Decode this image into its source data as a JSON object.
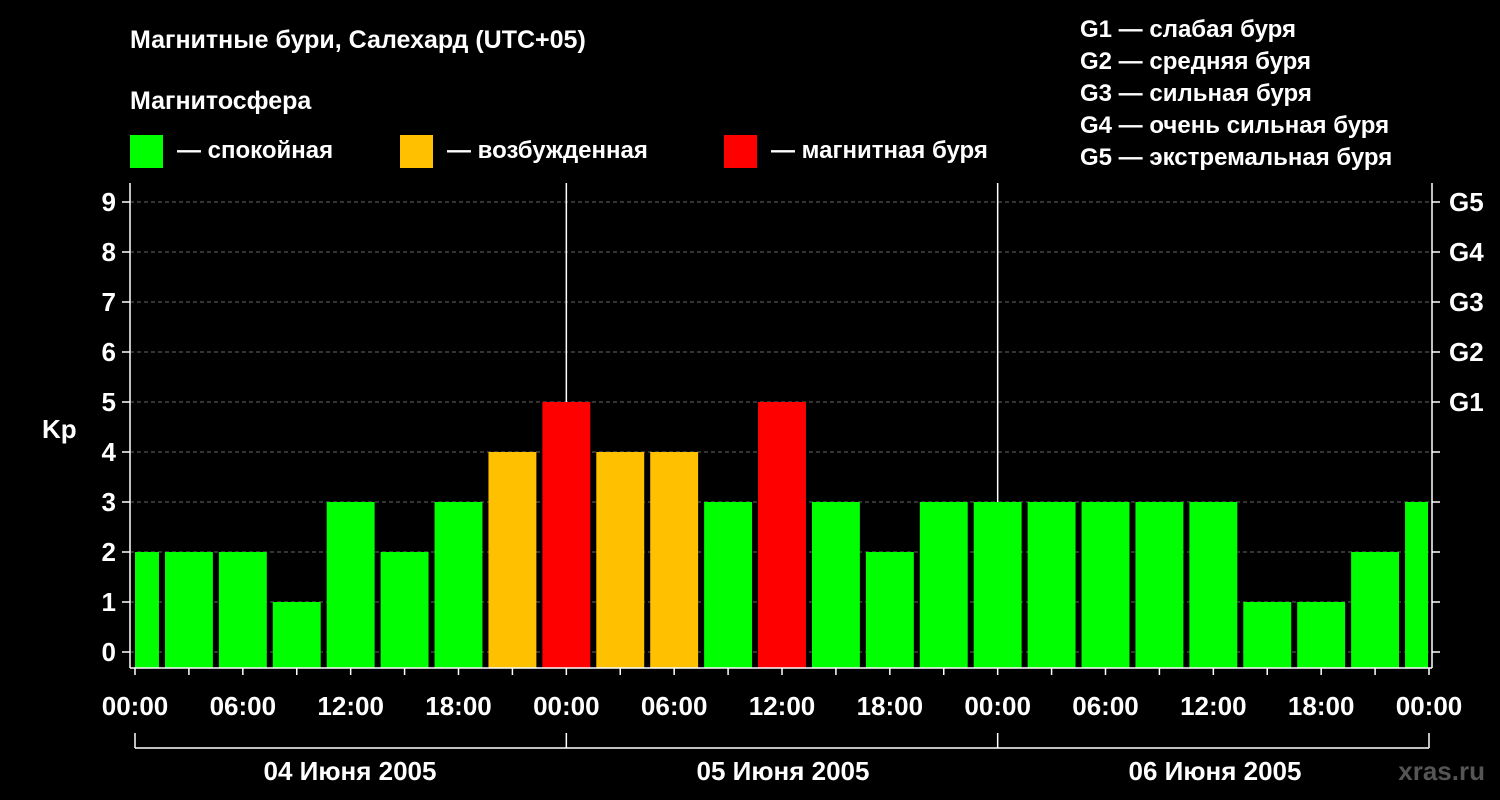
{
  "chart_data": {
    "type": "bar",
    "title": "Магнитные бури, Салехард (UTC+05)",
    "legend_header": "Магнитосфера",
    "legend": [
      {
        "label": "— спокойная",
        "color": "#00ff00"
      },
      {
        "label": "— возбужденная",
        "color": "#ffc000"
      },
      {
        "label": "— магнитная буря",
        "color": "#ff0000"
      }
    ],
    "g_scale_legend": [
      "G1 — слабая буря",
      "G2 — средняя буря",
      "G3 — сильная буря",
      "G4 — очень сильная буря",
      "G5 — экстремальная буря"
    ],
    "ylabel": "Kp",
    "ylim": [
      0,
      9
    ],
    "y_ticks": [
      "0",
      "1",
      "2",
      "3",
      "4",
      "5",
      "6",
      "7",
      "8",
      "9"
    ],
    "right_ticks": [
      {
        "value": 5,
        "label": "G1"
      },
      {
        "value": 6,
        "label": "G2"
      },
      {
        "value": 7,
        "label": "G3"
      },
      {
        "value": 8,
        "label": "G4"
      },
      {
        "value": 9,
        "label": "G5"
      }
    ],
    "x_tick_labels": [
      "00:00",
      "06:00",
      "12:00",
      "18:00",
      "00:00",
      "06:00",
      "12:00",
      "18:00",
      "00:00",
      "06:00",
      "12:00",
      "18:00",
      "00:00"
    ],
    "dates": [
      "04 Июня 2005",
      "05 Июня 2005",
      "06 Июня 2005"
    ],
    "interval_hours": 3,
    "start_hour": 0,
    "values": [
      2,
      2,
      2,
      1,
      3,
      2,
      3,
      4,
      5,
      4,
      4,
      3,
      5,
      3,
      2,
      3,
      3,
      3,
      3,
      3,
      3,
      1,
      1,
      2,
      3
    ],
    "level_colors": {
      "quiet": "#00ff00",
      "unsettled": "#ffc000",
      "storm": "#ff0000"
    },
    "grid": true
  },
  "watermark": "xras.ru"
}
